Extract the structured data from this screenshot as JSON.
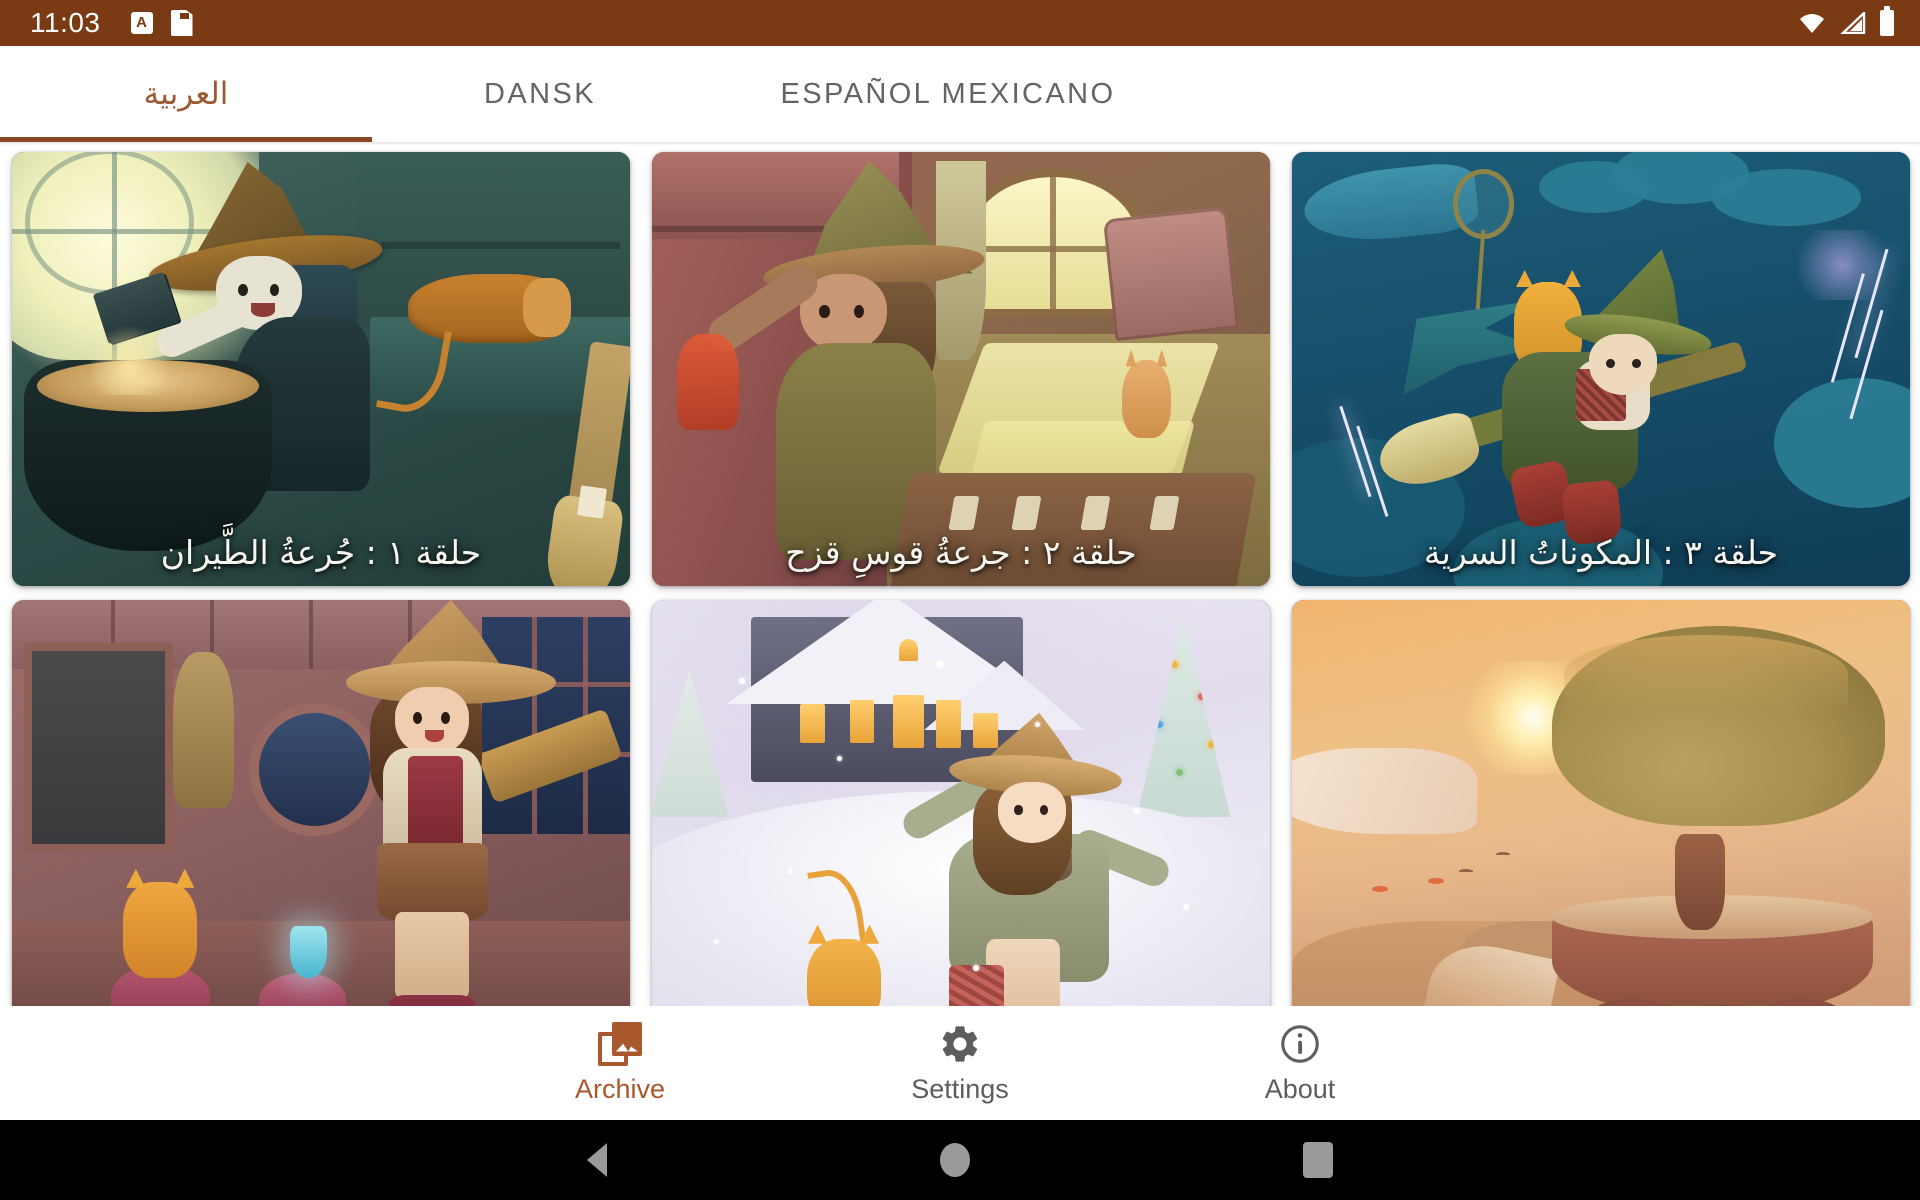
{
  "status_bar": {
    "clock": "11:03",
    "background": "#7a3a14",
    "icons": [
      "font-size-icon",
      "sd-card-icon",
      "wifi-icon",
      "signal-icon",
      "battery-icon"
    ]
  },
  "tabs": {
    "active_index": 0,
    "accent_color": "#8a4522",
    "items": [
      {
        "label": "العربية",
        "active": true
      },
      {
        "label": "DANSK",
        "active": false
      },
      {
        "label": "ESPAÑOL MEXICANO",
        "active": false
      }
    ]
  },
  "archive_grid": {
    "cards": [
      {
        "caption": "حلقة ١ : جُرعةُ الطَّيران",
        "scene": "witch-brewing-cauldron"
      },
      {
        "caption": "حلقة ٢ : جرعةُ قوسِ قزح",
        "scene": "witch-pouring-potion-cottage"
      },
      {
        "caption": "حلقة ٣ : المكوناتُ السرية",
        "scene": "witch-flying-broom-storm"
      },
      {
        "caption": "",
        "scene": "witch-observatory-cat-flask"
      },
      {
        "caption": "",
        "scene": "snowy-night-girl-cat"
      },
      {
        "caption": "",
        "scene": "sunset-great-tree-island"
      }
    ]
  },
  "bottom_nav": {
    "active_index": 0,
    "active_color": "#a8582c",
    "inactive_color": "#5d5d5d",
    "items": [
      {
        "label": "Archive",
        "icon": "photo-library-icon",
        "active": true
      },
      {
        "label": "Settings",
        "icon": "gear-icon",
        "active": false
      },
      {
        "label": "About",
        "icon": "info-icon",
        "active": false
      }
    ]
  },
  "android_nav": {
    "buttons": [
      "back-button",
      "home-button",
      "recents-button"
    ]
  }
}
